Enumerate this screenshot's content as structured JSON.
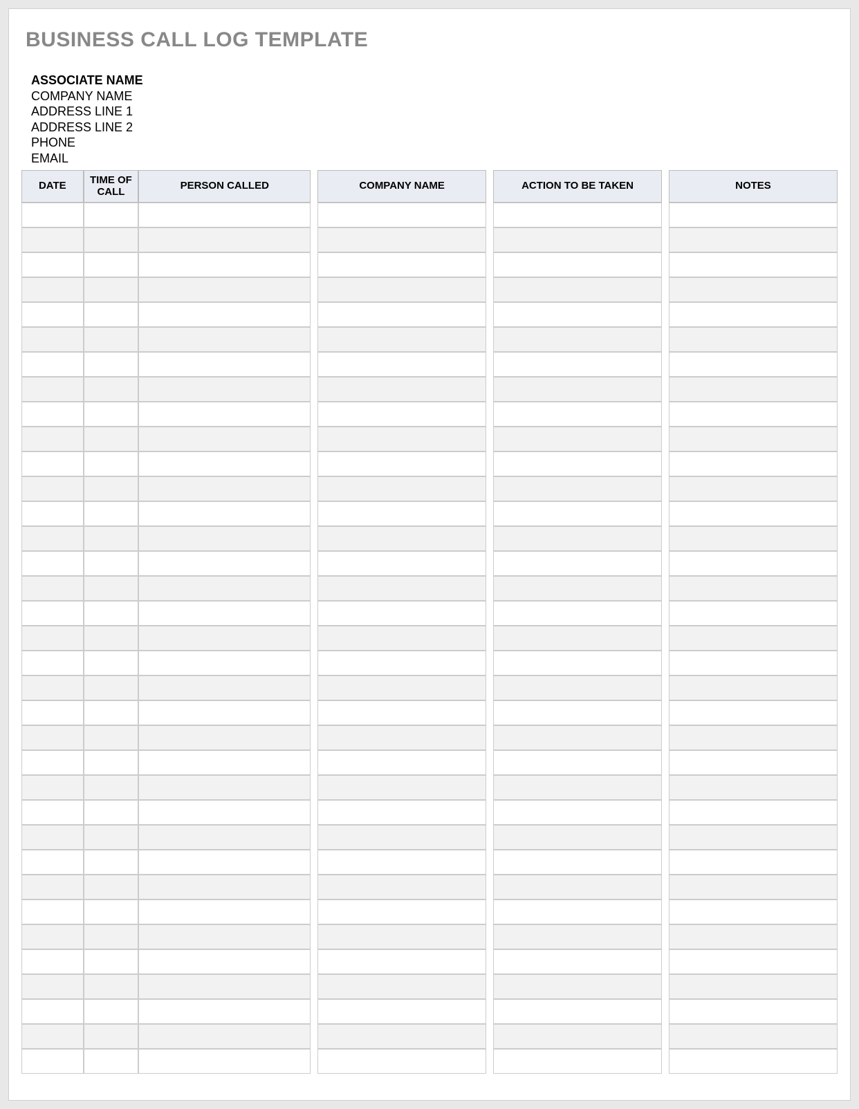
{
  "title": "BUSINESS CALL LOG TEMPLATE",
  "info": {
    "associate": "ASSOCIATE NAME",
    "company": "COMPANY NAME",
    "address1": "ADDRESS LINE 1",
    "address2": "ADDRESS LINE 2",
    "phone": "PHONE",
    "email": "EMAIL"
  },
  "columns": {
    "date": "DATE",
    "time": "TIME OF CALL",
    "person": "PERSON CALLED",
    "company": "COMPANY NAME",
    "action": "ACTION TO BE TAKEN",
    "notes": "NOTES"
  },
  "row_count": 35
}
